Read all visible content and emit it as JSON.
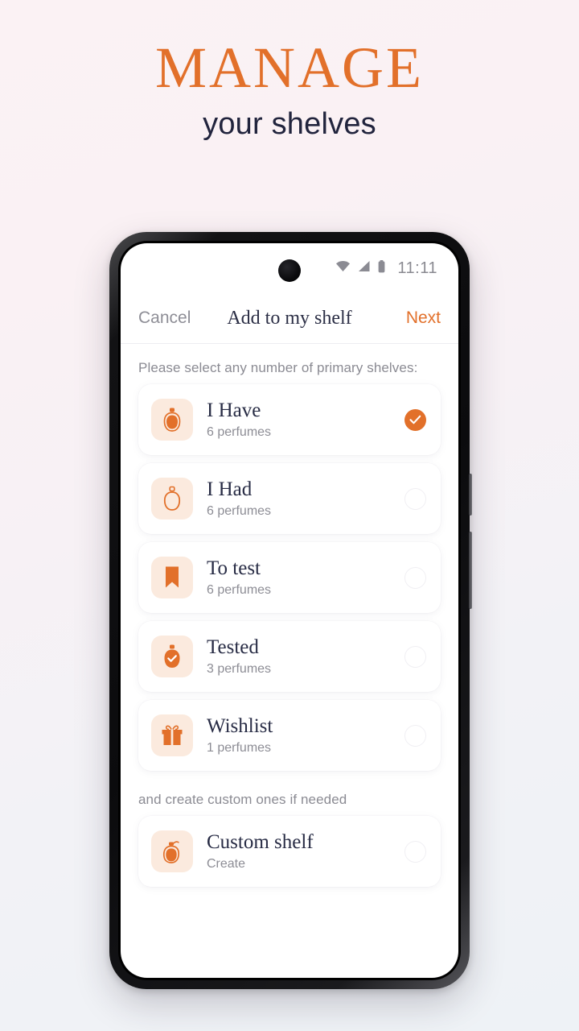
{
  "promo": {
    "title": "MANAGE",
    "subtitle": "your shelves",
    "accent_color": "#e2702a",
    "dark_color": "#21243d"
  },
  "status_bar": {
    "time": "11:11",
    "icons": [
      "wifi-icon",
      "signal-icon",
      "battery-icon"
    ]
  },
  "nav": {
    "cancel_label": "Cancel",
    "title": "Add to my shelf",
    "next_label": "Next"
  },
  "content": {
    "primary_section_label": "Please select any number of primary shelves:",
    "custom_section_label": "and create custom ones if needed",
    "primary_shelves": [
      {
        "title": "I Have",
        "subtitle": "6 perfumes",
        "icon": "perfume-bottle-filled-icon",
        "selected": true
      },
      {
        "title": "I Had",
        "subtitle": "6 perfumes",
        "icon": "perfume-bottle-outline-icon",
        "selected": false
      },
      {
        "title": "To test",
        "subtitle": "6 perfumes",
        "icon": "bookmark-icon",
        "selected": false
      },
      {
        "title": "Tested",
        "subtitle": "3 perfumes",
        "icon": "perfume-bottle-check-icon",
        "selected": false
      },
      {
        "title": "Wishlist",
        "subtitle": "1 perfumes",
        "icon": "gift-icon",
        "selected": false
      }
    ],
    "custom_shelves": [
      {
        "title": "Custom shelf",
        "subtitle": "Create",
        "icon": "perfume-spray-icon",
        "selected": false
      }
    ]
  }
}
